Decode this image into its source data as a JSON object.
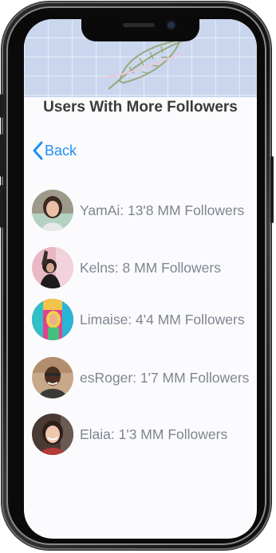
{
  "page_title": "Users With More Followers",
  "back_label": "Back",
  "users": [
    {
      "text": "YamAi: 13'8 MM Followers"
    },
    {
      "text": "Kelns: 8 MM Followers"
    },
    {
      "text": "Limaise: 4'4 MM Followers"
    },
    {
      "text": "esRoger: 1'7 MM Followers"
    },
    {
      "text": "Elaia: 1'3 MM Followers"
    }
  ],
  "colors": {
    "accent": "#1f8ef1",
    "header_bg": "#c9d6ee",
    "title": "#3b3b3b",
    "user_text": "#7f8590"
  }
}
